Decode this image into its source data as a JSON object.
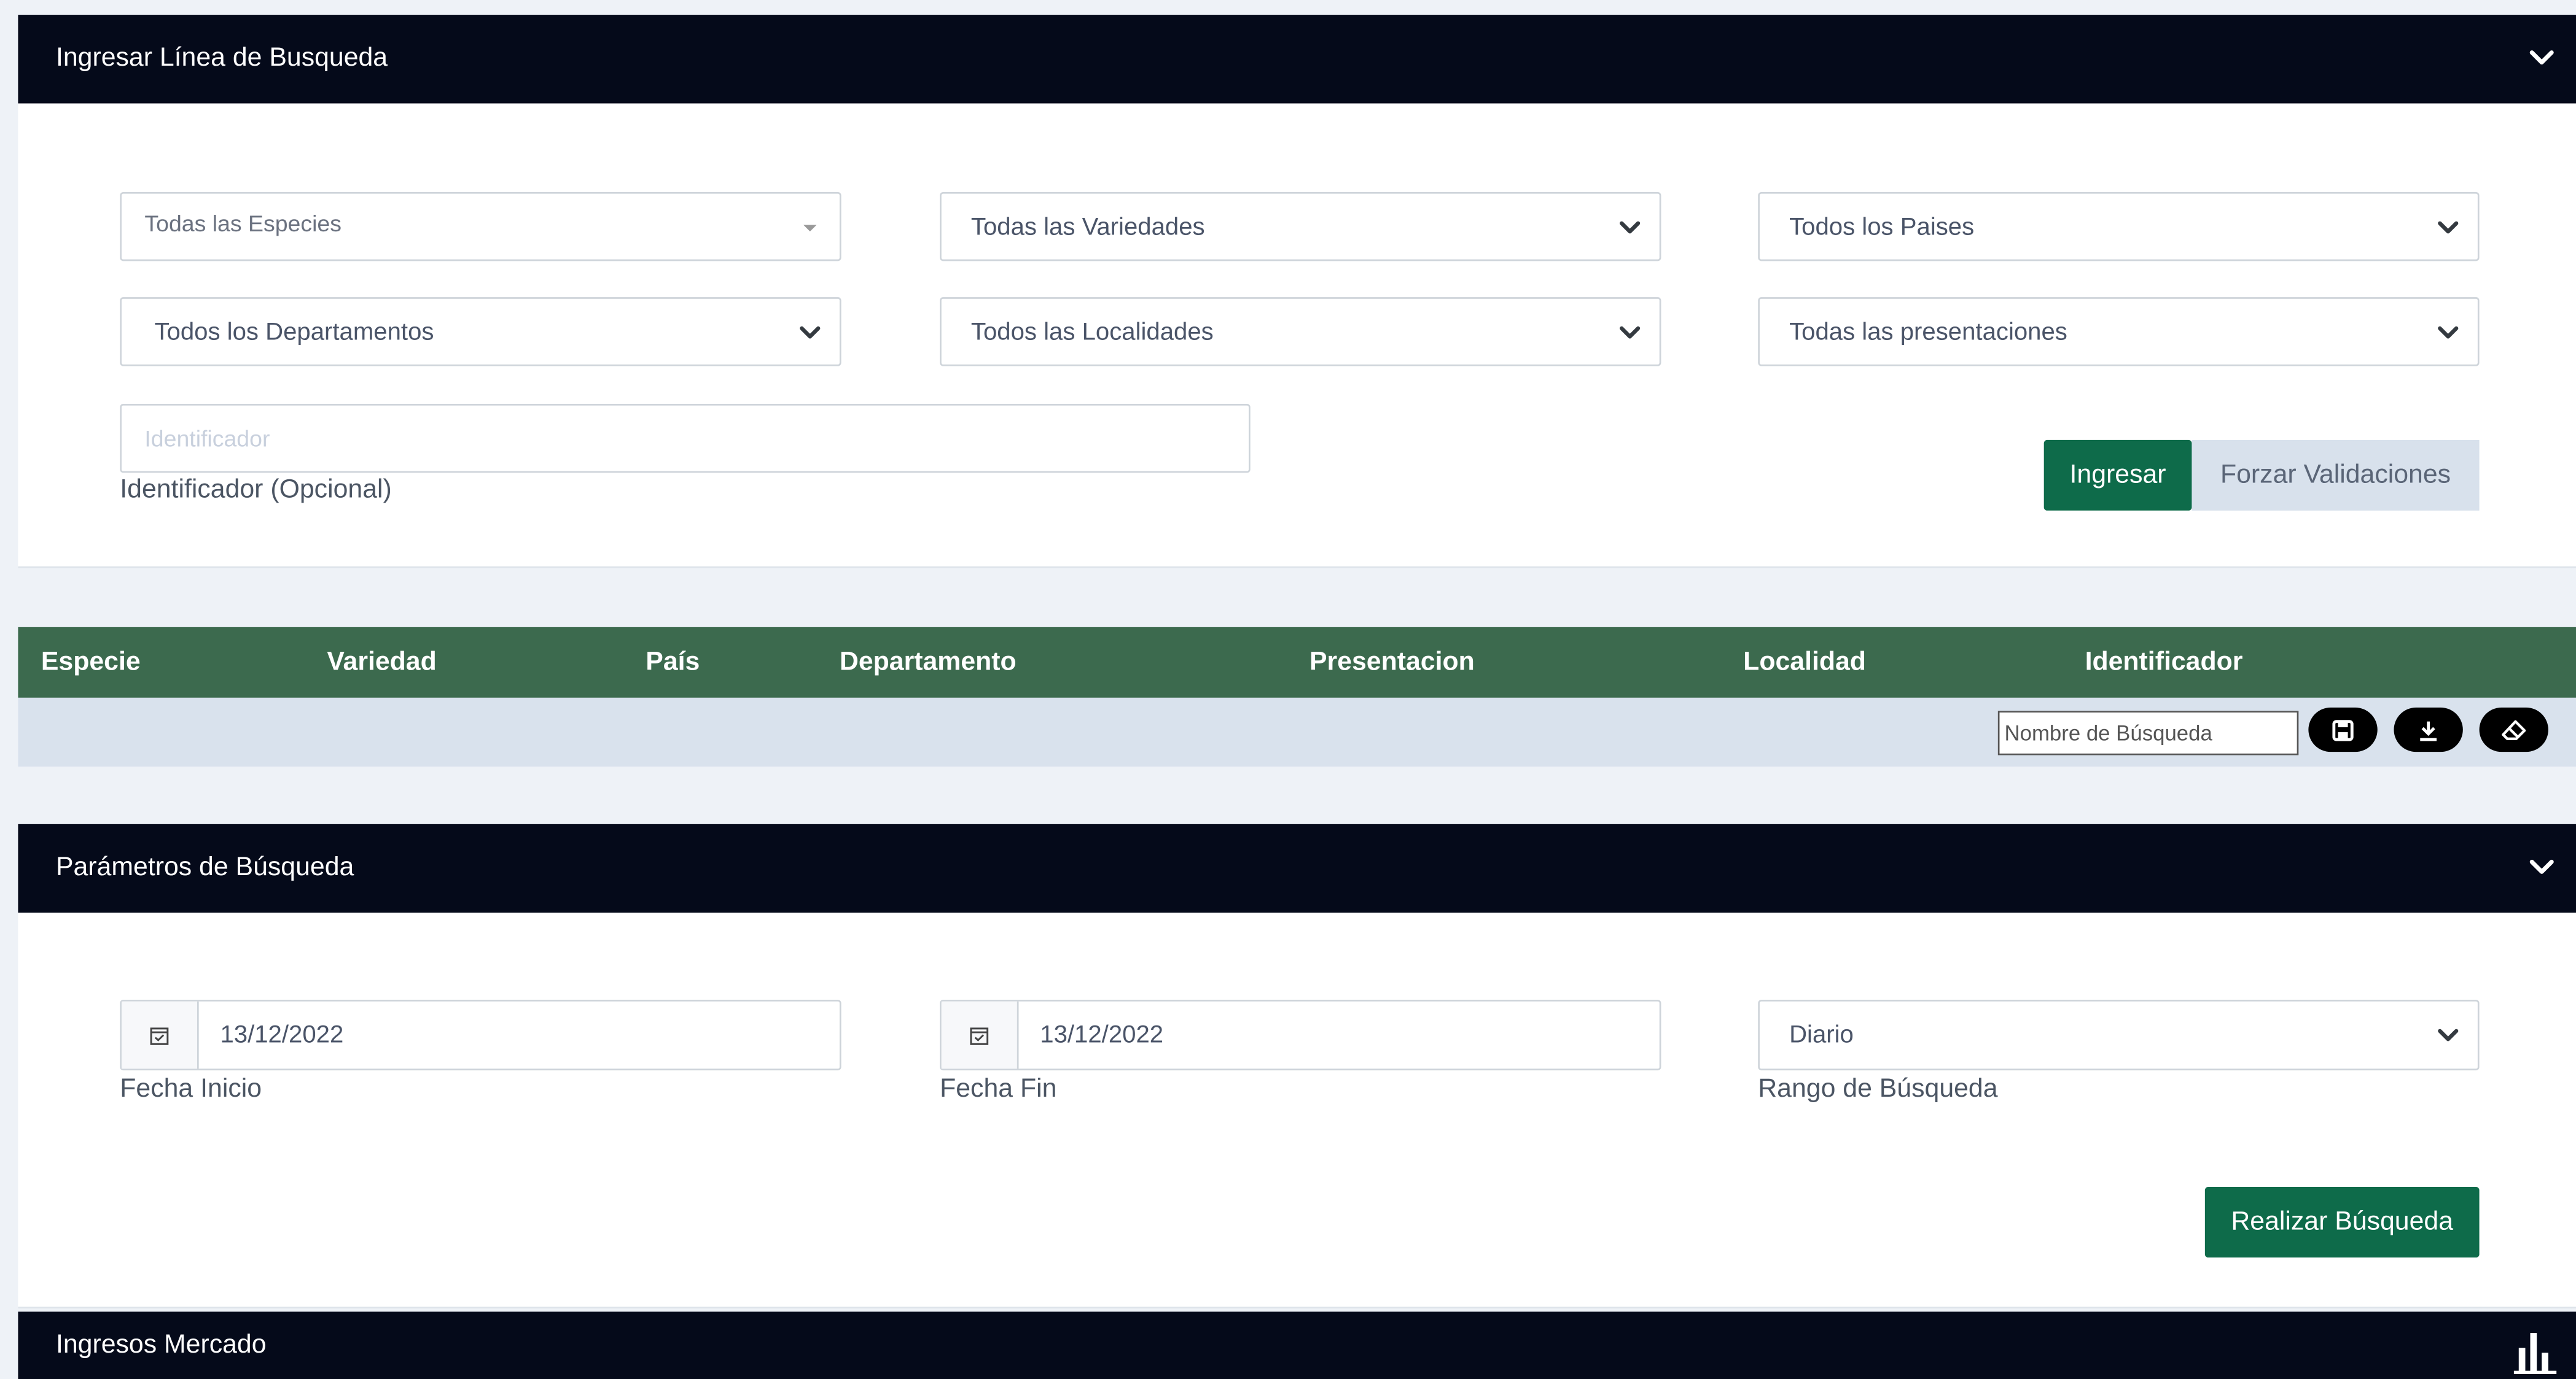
{
  "search_line": {
    "title": "Ingresar Línea de Busqueda",
    "especies": "Todas las Especies",
    "variedades": "Todas las Variedades",
    "paises": "Todos los Paises",
    "departamentos": "Todos los Departamentos",
    "localidades": "Todos las Localidades",
    "presentaciones": "Todas las presentaciones",
    "identifier_placeholder": "Identificador",
    "identifier_label": "Identificador (Opcional)",
    "ingresar_label": "Ingresar",
    "forzar_label": "Forzar Validaciones"
  },
  "table": {
    "columns": [
      "Especie",
      "Variedad",
      "País",
      "Departamento",
      "Presentacion",
      "Localidad",
      "Identificador"
    ],
    "search_name_placeholder": "Nombre de Búsqueda",
    "icons": [
      "save-icon",
      "download-icon",
      "eraser-icon"
    ]
  },
  "params": {
    "title": "Parámetros de Búsqueda",
    "fecha_inicio_value": "13/12/2022",
    "fecha_inicio_label": "Fecha Inicio",
    "fecha_fin_value": "13/12/2022",
    "fecha_fin_label": "Fecha Fin",
    "rango_value": "Diario",
    "rango_label": "Rango de Búsqueda",
    "search_button": "Realizar Búsqueda"
  },
  "market": {
    "title": "Ingresos Mercado",
    "icon": "bar-chart-icon"
  },
  "colors": {
    "header_bg": "#050a1a",
    "primary_green": "#0e6b4a",
    "table_header_green": "#3c6a4e",
    "toolbar_bg": "#d9e2ed"
  }
}
